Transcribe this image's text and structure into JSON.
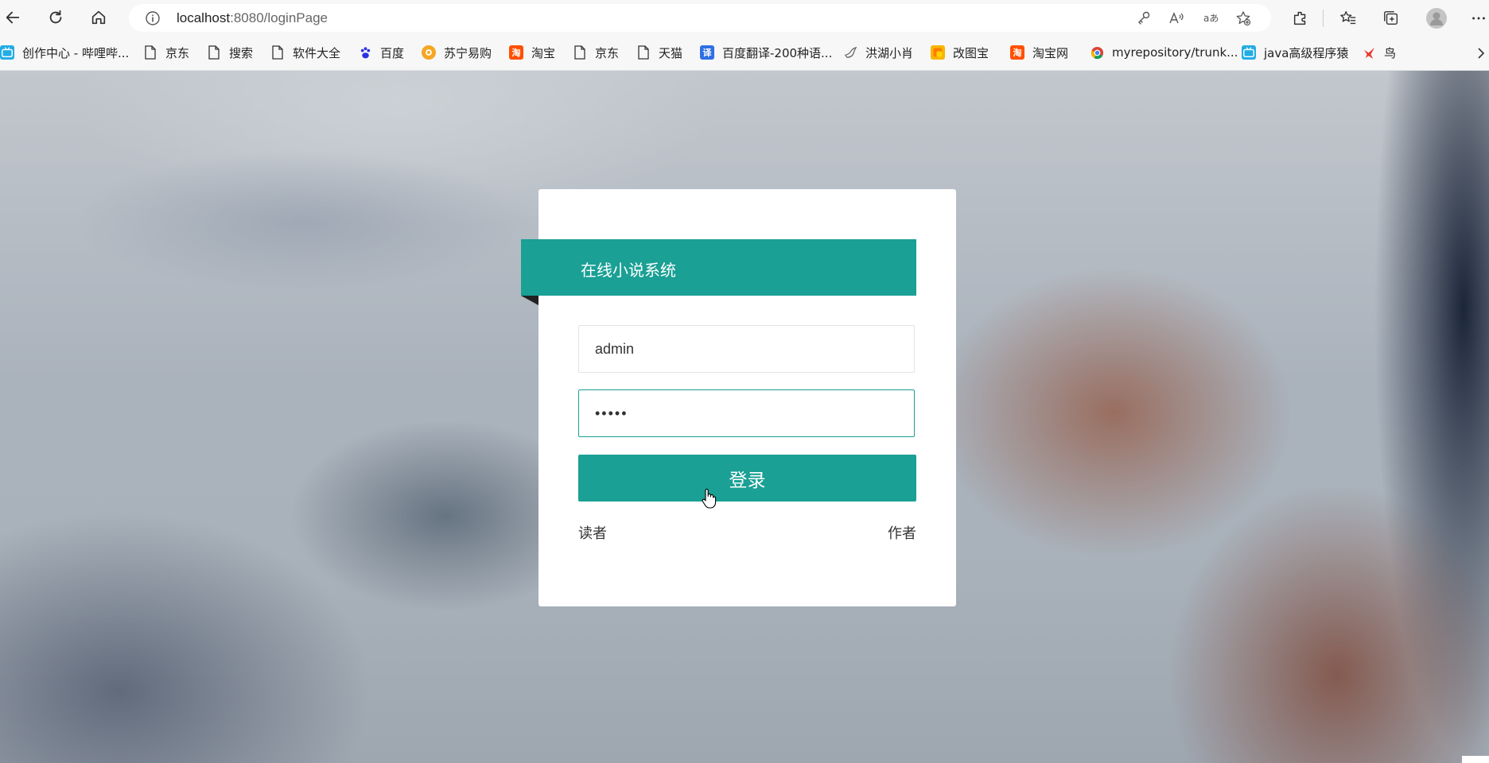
{
  "browser": {
    "url_host": "localhost",
    "url_path": ":8080/loginPage"
  },
  "bookmarks": [
    {
      "label": "创作中心 - 哔哩哔...",
      "icon": "bilibili-icon",
      "color": "#23ade5"
    },
    {
      "label": "京东",
      "icon": "page-icon"
    },
    {
      "label": "搜索",
      "icon": "page-icon"
    },
    {
      "label": "软件大全",
      "icon": "page-icon"
    },
    {
      "label": "百度",
      "icon": "baidu-paw-icon",
      "color": "#2932e1"
    },
    {
      "label": "苏宁易购",
      "icon": "suning-icon",
      "color": "#f5a623"
    },
    {
      "label": "淘宝",
      "icon": "taobao-icon",
      "color": "#ff5000"
    },
    {
      "label": "京东",
      "icon": "page-icon"
    },
    {
      "label": "天猫",
      "icon": "page-icon"
    },
    {
      "label": "百度翻译-200种语...",
      "icon": "baidu-translate-icon",
      "color": "#2f6fe4"
    },
    {
      "label": "洪湖小肖",
      "icon": "bird-icon",
      "color": "#666666"
    },
    {
      "label": "改图宝",
      "icon": "gaitubao-icon",
      "color": "#f7b500"
    },
    {
      "label": "淘宝网",
      "icon": "taobao-icon",
      "color": "#ff5000"
    },
    {
      "label": "myrepository/trunk...",
      "icon": "chrome-icon",
      "color": "#db4437"
    },
    {
      "label": "java高级程序猿",
      "icon": "bilibili-icon",
      "color": "#23ade5"
    },
    {
      "label": "鸟",
      "icon": "bird-red-icon",
      "color": "#e8382c"
    }
  ],
  "login": {
    "system_title": "在线小说系统",
    "username_value": "admin",
    "password_value": "•••••",
    "login_label": "登录",
    "reader_link": "读者",
    "author_link": "作者",
    "accent_color": "#1aa094"
  }
}
